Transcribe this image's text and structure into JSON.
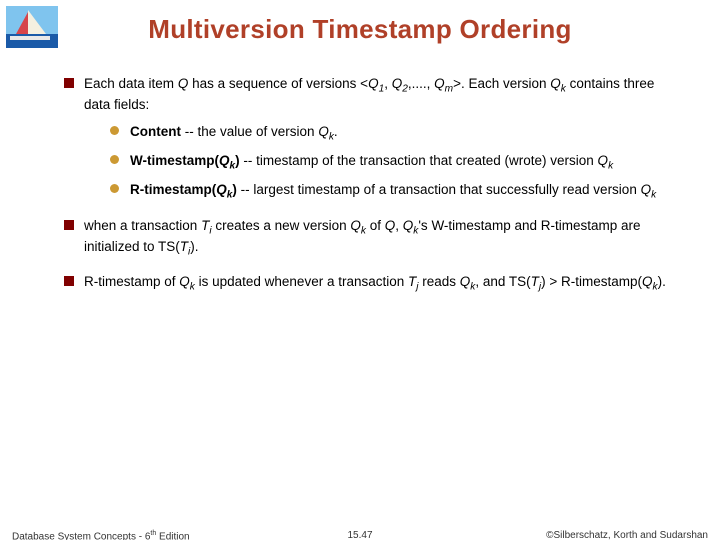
{
  "title": "Multiversion Timestamp Ordering",
  "bullets": {
    "b1": {
      "pre": "Each data item ",
      "Q": "Q",
      "mid1": " has a sequence of versions <",
      "Q1": "Q",
      "s1": "1",
      "c1": ", ",
      "Q2": "Q",
      "s2": "2",
      "c2": ",...., ",
      "Qm": "Q",
      "sm": "m",
      "post1": ">. Each version ",
      "Qk": "Q",
      "sk": "k",
      "post2": " contains three data fields:"
    },
    "b1a": {
      "label": "Content",
      "rest": " -- the value of version ",
      "Qk": "Q",
      "sk": "k",
      "dot": "."
    },
    "b1b": {
      "label": "W-timestamp",
      "lp": "(",
      "Qk": "Q",
      "sk": "k",
      "rp": ")",
      "rest1": " -- timestamp of the transaction that created (wrote) version ",
      "Qk2": "Q",
      "sk2": "k"
    },
    "b1c": {
      "label": "R-timestamp",
      "lp": "(",
      "Qk": "Q",
      "sk": "k",
      "rp": ")",
      "rest1": " -- largest timestamp of a transaction that successfully read version ",
      "Qk2": "Q",
      "sk2": "k"
    },
    "b2": {
      "pre": "when a transaction ",
      "T": "T",
      "si": "i",
      "mid1": " creates a new version ",
      "Qk": "Q",
      "sk": "k",
      "mid2": " of ",
      "Q": "Q",
      "mid3": ", ",
      "Qk2": "Q",
      "sk2": "k",
      "mid4": "'s W-timestamp and R-timestamp are initialized to TS(",
      "T2": "T",
      "si2": "i",
      "post": ")."
    },
    "b3": {
      "pre": "R-timestamp of ",
      "Qk": "Q",
      "sk": "k",
      "mid1": " is updated whenever a transaction ",
      "T": "T",
      "sj": "j",
      "mid2": " reads ",
      "Qk2": "Q",
      "sk2": "k",
      "mid3": ", and TS(",
      "T2": "T",
      "sj2": "j",
      "mid4": ") > R-timestamp(",
      "Qk3": "Q",
      "sk3": "k",
      "post": ")."
    }
  },
  "footer": {
    "left_pre": "Database System Concepts - 6",
    "left_sup": "th",
    "left_post": " Edition",
    "center": "15.47",
    "right": "©Silberschatz, Korth and Sudarshan"
  }
}
